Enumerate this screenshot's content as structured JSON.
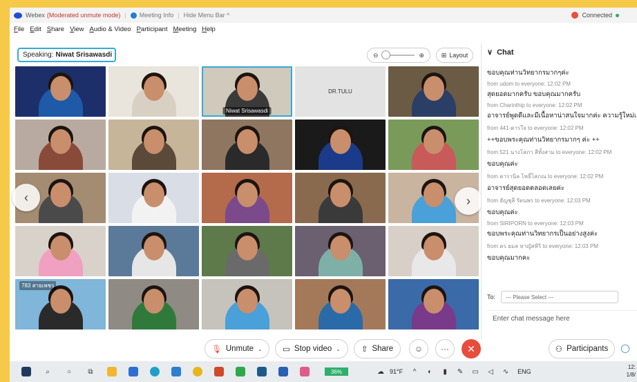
{
  "title_bar": {
    "app_name": "Webex",
    "mode": "(Moderated unmute mode)",
    "meeting_info": "Meeting Info",
    "hide_menu": "Hide Menu Bar ^",
    "status": "Connected"
  },
  "menu": [
    "File",
    "Edit",
    "Share",
    "View",
    "Audio & Video",
    "Participant",
    "Meeting",
    "Help"
  ],
  "toolbar": {
    "speaking_label": "Speaking:",
    "speaking_name": "Niwat Srisawasdi",
    "zoom_out": "⊖",
    "zoom_in": "⊕",
    "layout_label": "Layout"
  },
  "grid": {
    "tiles": [
      {
        "bg": "#1d2f6b",
        "shirt": "#1e5aa8",
        "label": ""
      },
      {
        "bg": "#e9e5dc",
        "shirt": "#d9d0c4",
        "label": ""
      },
      {
        "bg": "#cfcabb",
        "shirt": "#3a3a3a",
        "label": "Niwat Srisawasdi",
        "active": true
      },
      {
        "bg": "",
        "shirt": "",
        "label": "DR.TULU",
        "placeholder": true
      },
      {
        "bg": "#6b5b44",
        "shirt": "#2b3e66",
        "label": ""
      },
      {
        "bg": "#b8aaa0",
        "shirt": "#8a4a3a",
        "label": ""
      },
      {
        "bg": "#c7b59a",
        "shirt": "#5b4a3a",
        "label": ""
      },
      {
        "bg": "#8f7660",
        "shirt": "#2a2a2a",
        "label": ""
      },
      {
        "bg": "#1a1a1a",
        "shirt": "#1c3a8a",
        "label": ""
      },
      {
        "bg": "#7a9a5a",
        "shirt": "#c85a5a",
        "label": ""
      },
      {
        "bg": "#a48c72",
        "shirt": "#4a4a4a",
        "label": ""
      },
      {
        "bg": "#d9dde6",
        "shirt": "#f2f2f2",
        "label": ""
      },
      {
        "bg": "#b46b4b",
        "shirt": "#7a4a8a",
        "label": ""
      },
      {
        "bg": "#8a6a4e",
        "shirt": "#3a3a3a",
        "label": ""
      },
      {
        "bg": "#c9b4a0",
        "shirt": "#4aa0d8",
        "label": ""
      },
      {
        "bg": "#d8d2ca",
        "shirt": "#f0a0c0",
        "label": ""
      },
      {
        "bg": "#5b7a9a",
        "shirt": "#e6e6e6",
        "label": ""
      },
      {
        "bg": "#5e7a4a",
        "shirt": "#6a6a6a",
        "label": ""
      },
      {
        "bg": "#6a6070",
        "shirt": "#7fb0a8",
        "label": ""
      },
      {
        "bg": "#d8d0c8",
        "shirt": "#e8e8e8",
        "label": ""
      },
      {
        "bg": "#7fb6d9",
        "shirt": "#2a2a2a",
        "label": "783 สายเพชร"
      },
      {
        "bg": "#8f8a84",
        "shirt": "#2f7a3a",
        "label": ""
      },
      {
        "bg": "#c6c2bc",
        "shirt": "#4aa0d8",
        "label": ""
      },
      {
        "bg": "#a3795a",
        "shirt": "#2a6aa8",
        "label": ""
      },
      {
        "bg": "#3a6aa8",
        "shirt": "#7a3a8a",
        "label": ""
      }
    ]
  },
  "chat": {
    "header": "Chat",
    "messages": [
      {
        "from": "",
        "text": "ขอบคุณท่านวิทยากรมากๆค่ะ"
      },
      {
        "from": "from udom to everyone:   12:02 PM",
        "text": "สุดยอดมากครับ  ขอบคุณมากครับ"
      },
      {
        "from": "from Charinthip to everyone:   12:02 PM",
        "text": "อาจารย์พูดดีและมีเนื้อหาน่าสนใจมากค่ะ ความรู้ใหม่เยอะ"
      },
      {
        "from": "from 441-ดารใจ to everyone:   12:02 PM",
        "text": "++ขอบพระคุณท่านวิทยากรมากๆ ค่ะ ++"
      },
      {
        "from": "from 521 นางโสภา สีทั้งสาม to everyone:   12:02 PM",
        "text": "ขอบคุณค่ะ"
      },
      {
        "from": "from ดารานิล โพธิ์โสภณ to everyone:   12:02 PM",
        "text": "อาจารย์สุดยอดตลอดเลยค่ะ"
      },
      {
        "from": "from ธัญชุลี รัตนพร to everyone:   12:03 PM",
        "text": "ขอบคุณค่ะ"
      },
      {
        "from": "from SIRIPORN to everyone:   12:03 PM",
        "text": "ขอบพระคุณท่านวิทยากรเป็นอย่างสูงค่ะ"
      },
      {
        "from": "from ดร.ธมล หาญัสหิริ to everyone:   12:03 PM",
        "text": "ขอบคุณมากคะ"
      }
    ],
    "to_label": "To:",
    "to_select": "--- Please Select ---",
    "input_placeholder": "Enter chat message here"
  },
  "controls": {
    "unmute": "Unmute",
    "stop_video": "Stop video",
    "share": "Share",
    "participants": "Participants"
  },
  "taskbar": {
    "battery": "36%",
    "weather": "91°F",
    "lang": "ENG",
    "time": "12:",
    "date": "1/8/"
  }
}
